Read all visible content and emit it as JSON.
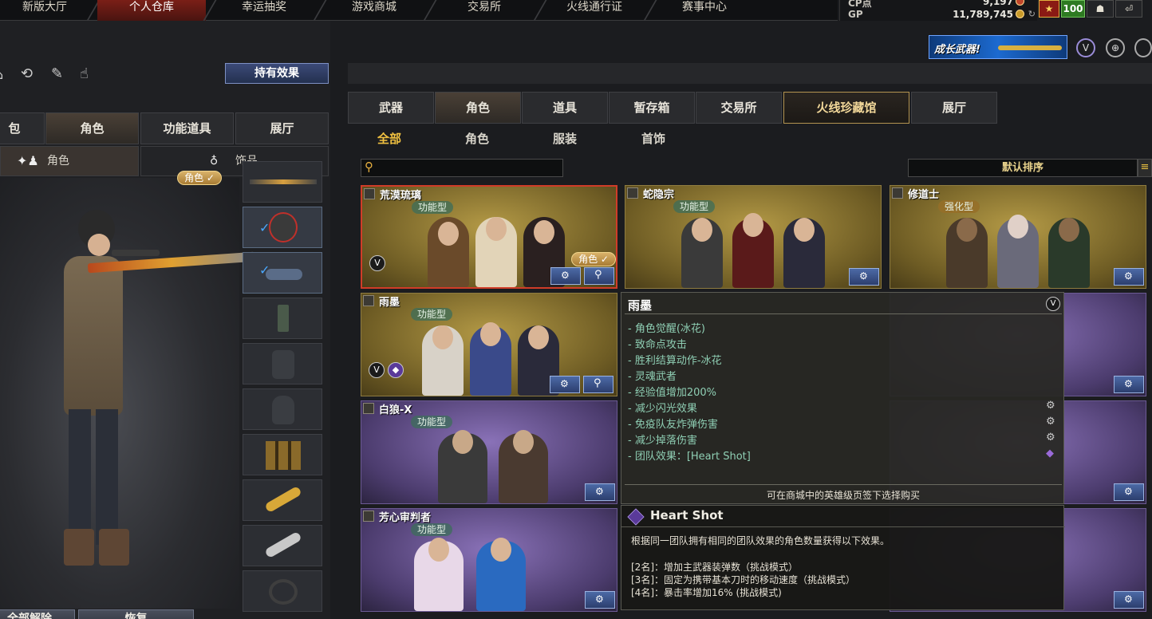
{
  "topnav": {
    "tabs": [
      "新版大厅",
      "个人仓库",
      "幸运抽奖",
      "游戏商城",
      "交易所",
      "火线通行证",
      "赛事中心"
    ],
    "active_index": 1
  },
  "currency": {
    "cp_label": "CP点",
    "cp_value": "9,197",
    "gp_label": "GP",
    "gp_value": "11,789,745",
    "level": "100"
  },
  "banner_text": "成长武器!",
  "left": {
    "effect_button": "持有效果",
    "tabs": [
      "包",
      "角色",
      "功能道具",
      "展厅"
    ],
    "active_tab": 1,
    "subtabs": [
      "角色",
      "饰品"
    ],
    "role_badge": "角色 ✓",
    "unequip_all": "全部解除",
    "restore": "恢复"
  },
  "right": {
    "tabs": [
      "武器",
      "角色",
      "道具",
      "暂存箱",
      "交易所",
      "火线珍藏馆",
      "展厅"
    ],
    "active_tab": 1,
    "filters": [
      "全部",
      "角色",
      "服装",
      "首饰"
    ],
    "active_filter": 0,
    "search_placeholder": "",
    "sort_label": "默认排序",
    "cards": [
      {
        "name": "荒漠琉璃",
        "type": "功能型",
        "role_badge": "角色 ✓"
      },
      {
        "name": "蛇隐宗",
        "type": "功能型"
      },
      {
        "name": "修道士",
        "type": "强化型"
      },
      {
        "name": "雨墨",
        "type": "功能型"
      },
      {
        "name": "白狼-X",
        "type": "功能型"
      },
      {
        "name": "芳心审判者",
        "type": "功能型"
      }
    ]
  },
  "tooltip": {
    "title": "雨墨",
    "badge": "V",
    "items": [
      "- 角色觉醒(冰花)",
      "- 致命点攻击",
      "- 胜利结算动作-冰花",
      "- 灵魂武者",
      "- 经验值增加200%",
      "- 减少闪光效果",
      "- 免疫队友炸弹伤害",
      "- 减少掉落伤害",
      "- 团队效果：[Heart Shot]"
    ],
    "footer": "可在商城中的英雄级页签下选择购买"
  },
  "tooltip2": {
    "title": "Heart Shot",
    "desc": "根据同一团队拥有相同的团队效果的角色数量获得以下效果。",
    "lines": [
      "[2名]：增加主武器装弹数（挑战模式）",
      "[3名]：固定为携带基本刀时的移动速度（挑战模式）",
      "[4名]：暴击率增加16% (挑战模式)"
    ]
  }
}
